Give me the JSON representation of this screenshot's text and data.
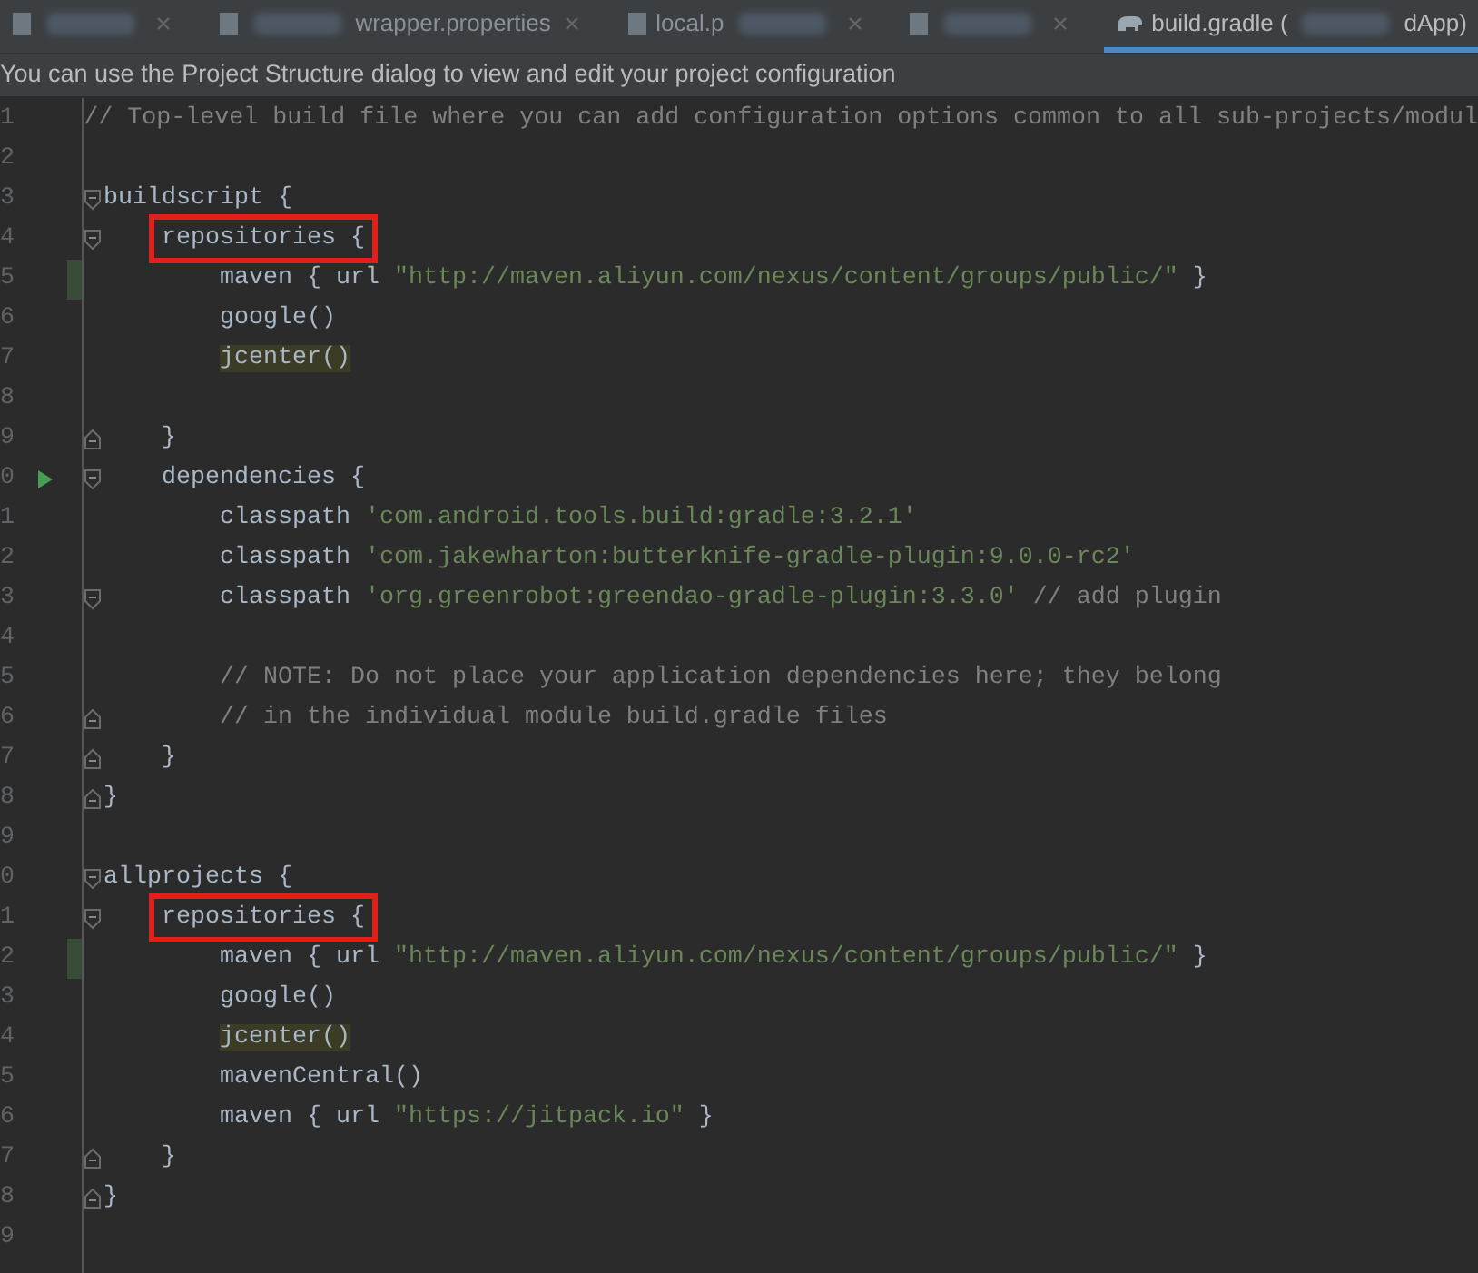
{
  "tabs": [
    {
      "selected": false,
      "parts": [
        {
          "kind": "blur"
        }
      ]
    },
    {
      "selected": false,
      "parts": [
        {
          "kind": "blur"
        },
        {
          "kind": "text",
          "text": "wrapper.properties"
        }
      ]
    },
    {
      "selected": false,
      "parts": [
        {
          "kind": "text",
          "text": "local.p"
        },
        {
          "kind": "blur"
        }
      ]
    },
    {
      "selected": false,
      "parts": [
        {
          "kind": "blur"
        }
      ]
    },
    {
      "selected": true,
      "parts": [
        {
          "kind": "text",
          "text": "build.gradle ("
        },
        {
          "kind": "blur"
        },
        {
          "kind": "text",
          "text": "dApp)"
        }
      ]
    }
  ],
  "notice": "You can use the Project Structure dialog to view and edit your project configuration",
  "lines": [
    {
      "number": "1",
      "tokens": [
        {
          "kind": "comment",
          "text": "// Top-level build file where you can add configuration options common to all sub-projects/modul"
        }
      ]
    },
    {
      "number": "2"
    },
    {
      "number": "3",
      "fold_start": true,
      "tokens": [
        {
          "kind": "plain",
          "text": "buildscript {"
        }
      ]
    },
    {
      "number": "4",
      "fold_start": true,
      "tokens": [
        {
          "kind": "boxed",
          "text": "    repositories {"
        }
      ]
    },
    {
      "number": "5",
      "changed": true,
      "tokens": [
        {
          "kind": "plain",
          "text": "        maven { url "
        },
        {
          "kind": "string",
          "text": "\"http://maven.aliyun.com/nexus/content/groups/public/\""
        },
        {
          "kind": "plain",
          "text": " }"
        }
      ]
    },
    {
      "number": "6",
      "tokens": [
        {
          "kind": "plain",
          "text": "        google()"
        }
      ]
    },
    {
      "number": "7",
      "tokens": [
        {
          "kind": "highlight",
          "text": "        jcenter()"
        }
      ]
    },
    {
      "number": "8"
    },
    {
      "number": "9",
      "fold_end": true,
      "tokens": [
        {
          "kind": "plain",
          "text": "    }"
        }
      ]
    },
    {
      "number": "0",
      "fold_start": true,
      "run": true,
      "tokens": [
        {
          "kind": "plain",
          "text": "    dependencies {"
        }
      ]
    },
    {
      "number": "1",
      "tokens": [
        {
          "kind": "plain",
          "text": "        classpath "
        },
        {
          "kind": "string",
          "text": "'com.android.tools.build:gradle:3.2.1'"
        }
      ]
    },
    {
      "number": "2",
      "tokens": [
        {
          "kind": "plain",
          "text": "        classpath "
        },
        {
          "kind": "string",
          "text": "'com.jakewharton:butterknife-gradle-plugin:9.0.0-rc2'"
        }
      ]
    },
    {
      "number": "3",
      "fold_start": true,
      "tokens": [
        {
          "kind": "plain",
          "text": "        classpath "
        },
        {
          "kind": "string",
          "text": "'org.greenrobot:greendao-gradle-plugin:3.3.0'"
        },
        {
          "kind": "comment",
          "text": " // add plugin"
        }
      ]
    },
    {
      "number": "4"
    },
    {
      "number": "5",
      "tokens": [
        {
          "kind": "comment",
          "text": "        // NOTE: Do not place your application dependencies here; they belong"
        }
      ]
    },
    {
      "number": "6",
      "fold_end": true,
      "tokens": [
        {
          "kind": "comment",
          "text": "        // in the individual module build.gradle files"
        }
      ]
    },
    {
      "number": "7",
      "fold_end": true,
      "tokens": [
        {
          "kind": "plain",
          "text": "    }"
        }
      ]
    },
    {
      "number": "8",
      "fold_end": true,
      "tokens": [
        {
          "kind": "plain",
          "text": "}"
        }
      ]
    },
    {
      "number": "9"
    },
    {
      "number": "0",
      "fold_start": true,
      "tokens": [
        {
          "kind": "plain",
          "text": "allprojects {"
        }
      ]
    },
    {
      "number": "1",
      "fold_start": true,
      "tokens": [
        {
          "kind": "boxed",
          "text": "    repositories {"
        }
      ]
    },
    {
      "number": "2",
      "changed": true,
      "tokens": [
        {
          "kind": "plain",
          "text": "        maven { url "
        },
        {
          "kind": "string",
          "text": "\"http://maven.aliyun.com/nexus/content/groups/public/\""
        },
        {
          "kind": "plain",
          "text": " }"
        }
      ]
    },
    {
      "number": "3",
      "tokens": [
        {
          "kind": "plain",
          "text": "        google()"
        }
      ]
    },
    {
      "number": "4",
      "tokens": [
        {
          "kind": "highlight",
          "text": "        jcenter()"
        }
      ]
    },
    {
      "number": "5",
      "tokens": [
        {
          "kind": "plain",
          "text": "        mavenCentral()"
        }
      ]
    },
    {
      "number": "6",
      "tokens": [
        {
          "kind": "plain",
          "text": "        maven { url "
        },
        {
          "kind": "string",
          "text": "\"https://jitpack.io\""
        },
        {
          "kind": "plain",
          "text": " }"
        }
      ]
    },
    {
      "number": "7",
      "fold_end": true,
      "tokens": [
        {
          "kind": "plain",
          "text": "    }"
        }
      ]
    },
    {
      "number": "8",
      "fold_end": true,
      "tokens": [
        {
          "kind": "plain",
          "text": "}"
        }
      ]
    },
    {
      "number": "9"
    }
  ]
}
